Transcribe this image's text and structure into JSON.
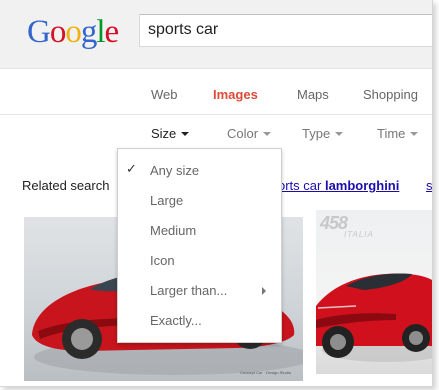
{
  "header": {
    "logo_letters": [
      {
        "char": "G",
        "color": "#3366cc"
      },
      {
        "char": "o",
        "color": "#d50f25"
      },
      {
        "char": "o",
        "color": "#eeb211"
      },
      {
        "char": "g",
        "color": "#3366cc"
      },
      {
        "char": "l",
        "color": "#009925"
      },
      {
        "char": "e",
        "color": "#d50f25"
      }
    ],
    "search_value": "sports car"
  },
  "tabs": [
    {
      "label": "Web",
      "active": false
    },
    {
      "label": "Images",
      "active": true
    },
    {
      "label": "Maps",
      "active": false
    },
    {
      "label": "Shopping",
      "active": false
    }
  ],
  "tools": [
    {
      "label": "Size",
      "active": true
    },
    {
      "label": "Color",
      "active": false
    },
    {
      "label": "Type",
      "active": false
    },
    {
      "label": "Time",
      "active": false
    }
  ],
  "related": {
    "label": "Related search",
    "link_prefix": "orts car ",
    "link_bold": "lamborghini",
    "more": "s"
  },
  "size_menu": {
    "items": [
      {
        "label": "Any size",
        "checked": true
      },
      {
        "label": "Large",
        "checked": false
      },
      {
        "label": "Medium",
        "checked": false
      },
      {
        "label": "Icon",
        "checked": false
      },
      {
        "label": "Larger than...",
        "checked": false,
        "submenu": true
      },
      {
        "label": "Exactly...",
        "checked": false
      }
    ],
    "check_glyph": "✓"
  },
  "thumbnails": {
    "second_badge": "458",
    "second_badge_sub": "ITALIA",
    "first_caption": "Concept Car · Design Studio"
  },
  "colors": {
    "accent_red": "#dd4b39",
    "link_blue": "#1a0dab",
    "car_red": "#c8141c"
  }
}
